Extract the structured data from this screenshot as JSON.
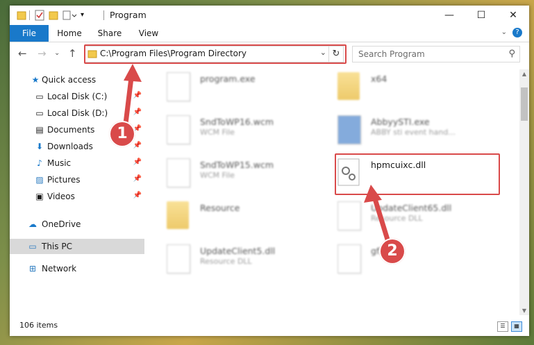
{
  "window": {
    "title": "Program",
    "minimize": "—",
    "maximize": "☐",
    "close": "✕"
  },
  "ribbon": {
    "tabs": [
      "File",
      "Home",
      "Share",
      "View"
    ],
    "help": "?"
  },
  "nav": {
    "address": "C:\\Program Files\\Program Directory",
    "search_placeholder": "Search Program"
  },
  "sidebar": {
    "items": [
      {
        "label": "Quick access",
        "icon": "star-icon"
      },
      {
        "label": "Local Disk (C:)",
        "icon": "drive-icon",
        "pinned": true
      },
      {
        "label": "Local Disk (D:)",
        "icon": "drive-icon",
        "pinned": true
      },
      {
        "label": "Documents",
        "icon": "documents-icon",
        "pinned": true
      },
      {
        "label": "Downloads",
        "icon": "download-icon",
        "pinned": true
      },
      {
        "label": "Music",
        "icon": "music-icon",
        "pinned": true
      },
      {
        "label": "Pictures",
        "icon": "pictures-icon",
        "pinned": true
      },
      {
        "label": "Videos",
        "icon": "videos-icon",
        "pinned": true
      },
      {
        "label": "OneDrive",
        "icon": "cloud-icon"
      },
      {
        "label": "This PC",
        "icon": "computer-icon",
        "selected": true
      },
      {
        "label": "Network",
        "icon": "network-icon"
      }
    ]
  },
  "files": [
    {
      "name": "program.exe",
      "type": ""
    },
    {
      "name": "x64",
      "type": ""
    },
    {
      "name": "SndToWP16.wcm",
      "type": "WCM File"
    },
    {
      "name": "AbbyySTI.exe",
      "type": "ABBY sti event hand..."
    },
    {
      "name": "SndToWP15.wcm",
      "type": "WCM File"
    },
    {
      "name": "hpmcuixc.dll",
      "type": ""
    },
    {
      "name": "Resource",
      "type": ""
    },
    {
      "name": "UpdateClient65.dll",
      "type": "Resource DLL"
    },
    {
      "name": "UpdateClient5.dll",
      "type": "Resource DLL"
    },
    {
      "name": "gf...",
      "type": ""
    }
  ],
  "status": {
    "count": "106 items"
  },
  "callouts": [
    "1",
    "2"
  ],
  "colors": {
    "accent": "#1979ca",
    "highlight": "#d94a4a"
  }
}
